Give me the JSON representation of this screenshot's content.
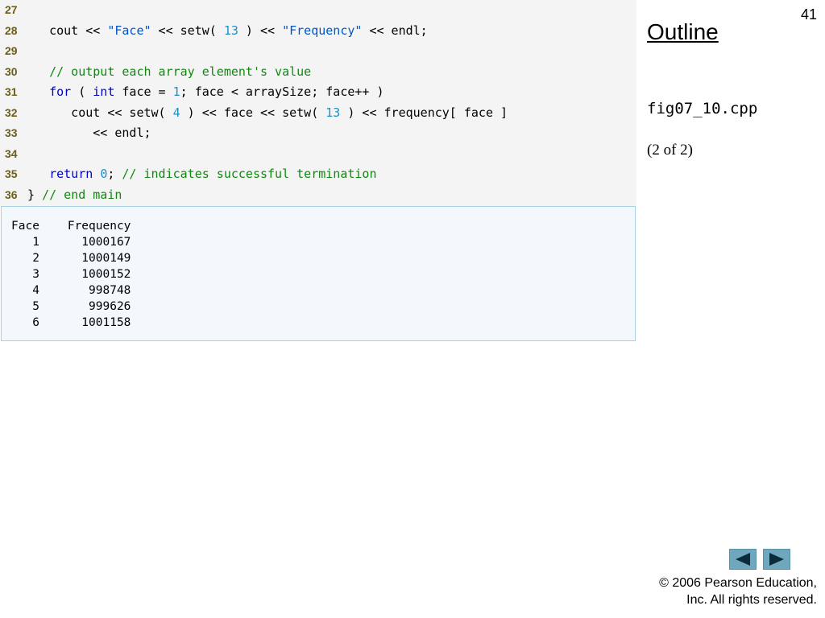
{
  "slide_number": "41",
  "sidebar": {
    "outline_title": "Outline",
    "file_name": "fig07_10.cpp",
    "page_of": "(2 of 2)"
  },
  "code_lines": [
    {
      "number": "27",
      "tokens": []
    },
    {
      "number": "28",
      "tokens": [
        {
          "text": "   cout << ",
          "type": "plain"
        },
        {
          "text": "\"Face\"",
          "type": "str"
        },
        {
          "text": " << setw( ",
          "type": "plain"
        },
        {
          "text": "13",
          "type": "num"
        },
        {
          "text": " ) << ",
          "type": "plain"
        },
        {
          "text": "\"Frequency\"",
          "type": "str"
        },
        {
          "text": " << endl;",
          "type": "plain"
        }
      ]
    },
    {
      "number": "29",
      "tokens": []
    },
    {
      "number": "30",
      "tokens": [
        {
          "text": "   // output each array element's value",
          "type": "cm"
        }
      ]
    },
    {
      "number": "31",
      "tokens": [
        {
          "text": "   ",
          "type": "plain"
        },
        {
          "text": "for",
          "type": "kw"
        },
        {
          "text": " ( ",
          "type": "plain"
        },
        {
          "text": "int",
          "type": "kw"
        },
        {
          "text": " face = ",
          "type": "plain"
        },
        {
          "text": "1",
          "type": "num"
        },
        {
          "text": "; face < arraySize; face++ )",
          "type": "plain"
        }
      ]
    },
    {
      "number": "32",
      "tokens": [
        {
          "text": "      cout << setw( ",
          "type": "plain"
        },
        {
          "text": "4",
          "type": "num"
        },
        {
          "text": " ) << face << setw( ",
          "type": "plain"
        },
        {
          "text": "13",
          "type": "num"
        },
        {
          "text": " ) << frequency[ face ]",
          "type": "plain"
        }
      ]
    },
    {
      "number": "33",
      "tokens": [
        {
          "text": "         << endl;",
          "type": "plain"
        }
      ]
    },
    {
      "number": "34",
      "tokens": []
    },
    {
      "number": "35",
      "tokens": [
        {
          "text": "   ",
          "type": "plain"
        },
        {
          "text": "return",
          "type": "kw"
        },
        {
          "text": " ",
          "type": "plain"
        },
        {
          "text": "0",
          "type": "num"
        },
        {
          "text": "; ",
          "type": "plain"
        },
        {
          "text": "// indicates successful termination",
          "type": "cm"
        }
      ]
    },
    {
      "number": "36",
      "tokens": [
        {
          "text": "} ",
          "type": "plain"
        },
        {
          "text": "// end main",
          "type": "cm"
        }
      ]
    }
  ],
  "output_lines": [
    "Face    Frequency",
    "   1      1000167",
    "   2      1000149",
    "   3      1000152",
    "   4       998748",
    "   5       999626",
    "   6      1001158"
  ],
  "nav": {
    "prev_icon": "triangle-left-icon",
    "next_icon": "triangle-right-icon"
  },
  "copyright": {
    "line1": "© 2006 Pearson Education,",
    "line2": "Inc.  All rights reserved."
  },
  "colors": {
    "code_bg": "#f4f4f4",
    "output_bg": "#f2f8fc",
    "output_border": "#a9cfe3",
    "line_number": "#6b5e18",
    "keyword": "#0000cc",
    "string": "#0055cc",
    "number": "#1e90c8",
    "comment": "#118811",
    "nav_button": "#6fa8bd"
  }
}
